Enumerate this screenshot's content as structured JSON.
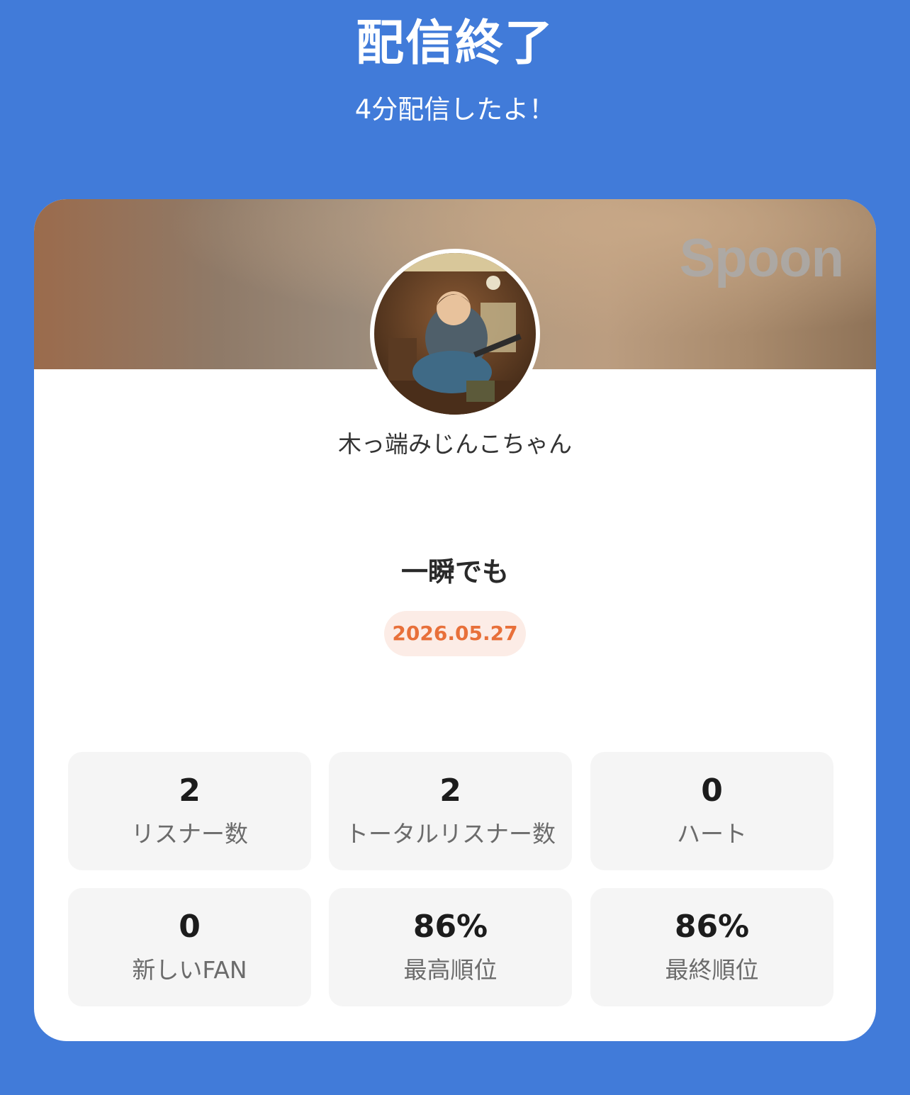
{
  "header": {
    "title": "配信終了",
    "subtitle": "4分配信したよ！"
  },
  "card": {
    "brand": "Spoon",
    "avatar_icon": "dj-avatar-image",
    "username": "木っ端みじんこちゃん",
    "stream_title": "一瞬でも",
    "date": "2026.05.27"
  },
  "stats": [
    {
      "value": "2",
      "label": "リスナー数"
    },
    {
      "value": "2",
      "label": "トータルリスナー数"
    },
    {
      "value": "0",
      "label": "ハート"
    },
    {
      "value": "0",
      "label": "新しいFAN"
    },
    {
      "value": "86%",
      "label": "最高順位"
    },
    {
      "value": "86%",
      "label": "最終順位"
    }
  ],
  "colors": {
    "background": "#417bd9",
    "date_badge_bg": "#fcece6",
    "date_badge_text": "#e8703a"
  }
}
